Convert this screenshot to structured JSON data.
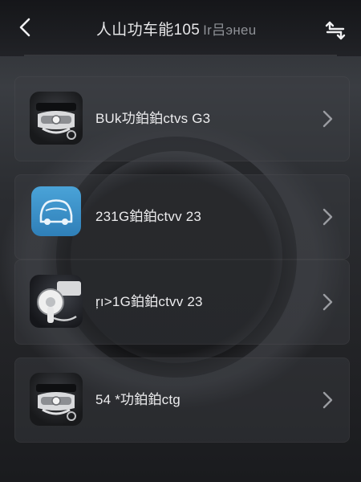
{
  "header": {
    "title": "人山功车能105",
    "subtitle": "Ir吕энеu",
    "back_icon": "chevron-left-icon",
    "switch_icon": "swap-arrows-icon"
  },
  "vehicles": [
    {
      "label": "BUk功鉑鉑ctvs G3",
      "icon": "car-front-icon"
    },
    {
      "label": "231G鉑鉑ctvv 23",
      "icon": "car-outline-icon"
    },
    {
      "label": "ŗı>1G鉑鉑ctvv 23",
      "icon": "steering-key-icon"
    },
    {
      "label": "54 *功鉑鉑ctg",
      "icon": "car-front-icon"
    }
  ],
  "colors": {
    "accent_blue": "#3b93cf",
    "text": "#ececee",
    "chevron": "#9a9ca1"
  }
}
